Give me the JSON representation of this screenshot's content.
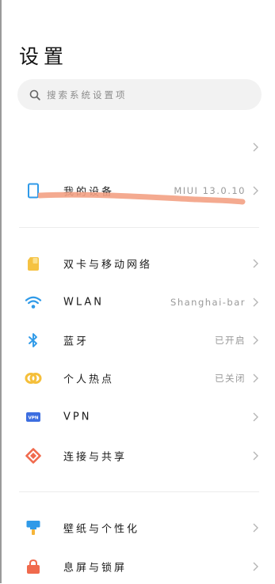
{
  "page": {
    "title": "设置"
  },
  "search": {
    "placeholder": "搜索系统设置项"
  },
  "top_row": {
    "label": ""
  },
  "device": {
    "label": "我的设备",
    "value": "MIUI 13.0.10"
  },
  "network": {
    "items": [
      {
        "label": "双卡与移动网络",
        "value": "",
        "icon": "sim-card-icon",
        "color": "#f5c242"
      },
      {
        "label": "WLAN",
        "value": "Shanghai-bar",
        "icon": "wifi-icon",
        "color": "#2f9ae8"
      },
      {
        "label": "蓝牙",
        "value": "已开启",
        "icon": "bluetooth-icon",
        "color": "#2f9ae8"
      },
      {
        "label": "个人热点",
        "value": "已关闭",
        "icon": "hotspot-icon",
        "color": "#f5bf3a"
      },
      {
        "label": "VPN",
        "value": "",
        "icon": "vpn-icon",
        "color": "#3d6ee0"
      },
      {
        "label": "连接与共享",
        "value": "",
        "icon": "connection-sharing-icon",
        "color": "#f06a4d"
      }
    ]
  },
  "personal": {
    "items": [
      {
        "label": "壁纸与个性化",
        "value": "",
        "icon": "wallpaper-icon",
        "color": "#2f9ae8"
      },
      {
        "label": "息屏与锁屏",
        "value": "",
        "icon": "lock-screen-icon",
        "color": "#f06a4d"
      }
    ]
  },
  "annotation": {
    "color": "#f3a184"
  }
}
